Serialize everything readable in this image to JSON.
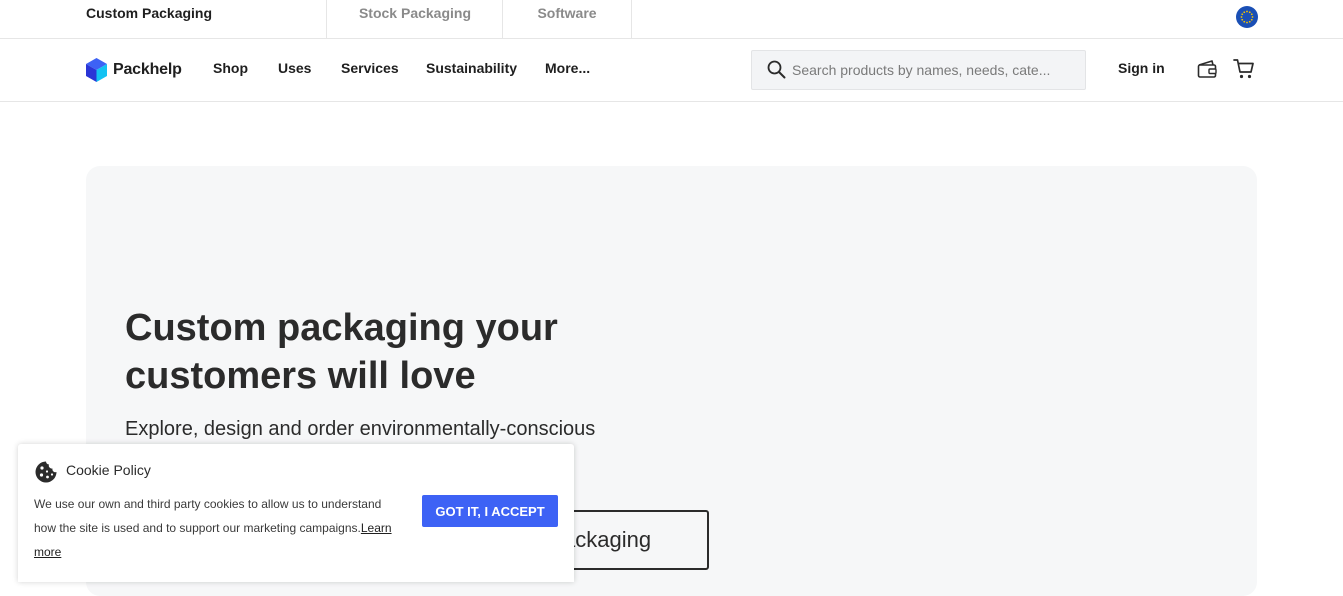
{
  "top_tabs": [
    "Custom Packaging",
    "Stock Packaging",
    "Software"
  ],
  "region_flag": "eu-flag-icon",
  "brand": {
    "name": "Packhelp",
    "color_top": "#3d62f5",
    "color_left": "#2a35d6",
    "color_right": "#13c2f2"
  },
  "nav": {
    "items": [
      "Shop",
      "Uses",
      "Services",
      "Sustainability",
      "More..."
    ],
    "search_placeholder": "Search products by names, needs, cate...",
    "sign_in": "Sign in",
    "icons": [
      "search-icon",
      "wallet-icon",
      "cart-icon"
    ]
  },
  "hero": {
    "title": "Custom packaging your customers will love",
    "subtitle": "Explore, design and order environmentally-conscious",
    "cta_visible": "ackaging"
  },
  "cookie": {
    "title": "Cookie Policy",
    "text": "We use our own and third party cookies to allow us to understand how the site is used and to support our marketing campaigns.",
    "link": "Learn more",
    "accept": "GOT IT, I ACCEPT",
    "accent": "#3d62f5"
  }
}
